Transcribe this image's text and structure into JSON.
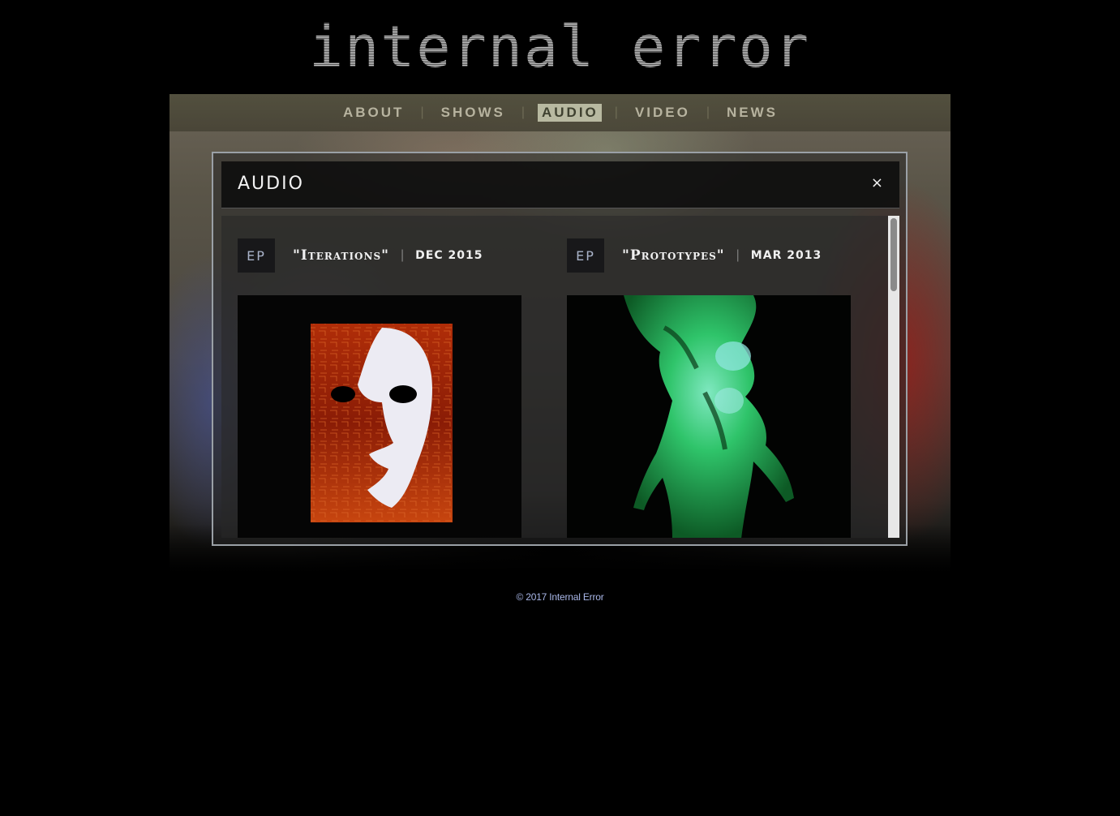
{
  "site": {
    "logo_text": "internal error"
  },
  "nav": {
    "items": [
      {
        "label": "ABOUT",
        "active": false
      },
      {
        "label": "SHOWS",
        "active": false
      },
      {
        "label": "AUDIO",
        "active": true
      },
      {
        "label": "VIDEO",
        "active": false
      },
      {
        "label": "NEWS",
        "active": false
      }
    ],
    "separator": "|"
  },
  "modal": {
    "title": "AUDIO",
    "close_label": "×",
    "releases": [
      {
        "type": "EP",
        "title": "\"Iterations\"",
        "date": "DEC 2015",
        "cover_icon": "mask-face-cover-art"
      },
      {
        "type": "EP",
        "title": "\"Prototypes\"",
        "date": "MAR 2013",
        "cover_icon": "green-figure-cover-art"
      }
    ],
    "release_separator": "|"
  },
  "footer": {
    "copyright": "© 2017 Internal Error"
  },
  "colors": {
    "page_background": "#000000",
    "nav_text": "#b7b39f",
    "nav_active_bg": "#b8b9a1",
    "footer_text": "#a9b7e8",
    "modal_border": "#9aa0a6"
  }
}
